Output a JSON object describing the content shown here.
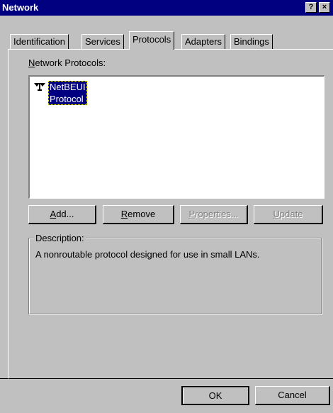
{
  "window": {
    "title": "Network",
    "help_label": "?",
    "close_label": "×"
  },
  "tabs": [
    {
      "label": "Identification"
    },
    {
      "label": "Services"
    },
    {
      "label": "Protocols"
    },
    {
      "label": "Adapters"
    },
    {
      "label": "Bindings"
    }
  ],
  "active_tab": "Protocols",
  "protocols_panel": {
    "list_label_first": "N",
    "list_label_rest": "etwork Protocols:",
    "items": [
      {
        "label": "NetBEUI Protocol",
        "selected": true,
        "icon": "network-protocol-icon"
      }
    ],
    "buttons": {
      "add": {
        "mnemonic": "A",
        "rest": "dd...",
        "enabled": true
      },
      "remove": {
        "mnemonic": "R",
        "rest": "emove",
        "enabled": true
      },
      "properties": {
        "mnemonic": "P",
        "rest": "roperties...",
        "enabled": false
      },
      "update": {
        "mnemonic": "U",
        "rest": "pdate",
        "enabled": false
      }
    },
    "description": {
      "legend": "Description:",
      "text": "A nonroutable protocol designed for use in small LANs."
    }
  },
  "footer": {
    "ok_label": "OK",
    "cancel_label": "Cancel"
  },
  "colors": {
    "titlebar": "#000080",
    "face": "#c0c0c0",
    "selection": "#000080"
  }
}
